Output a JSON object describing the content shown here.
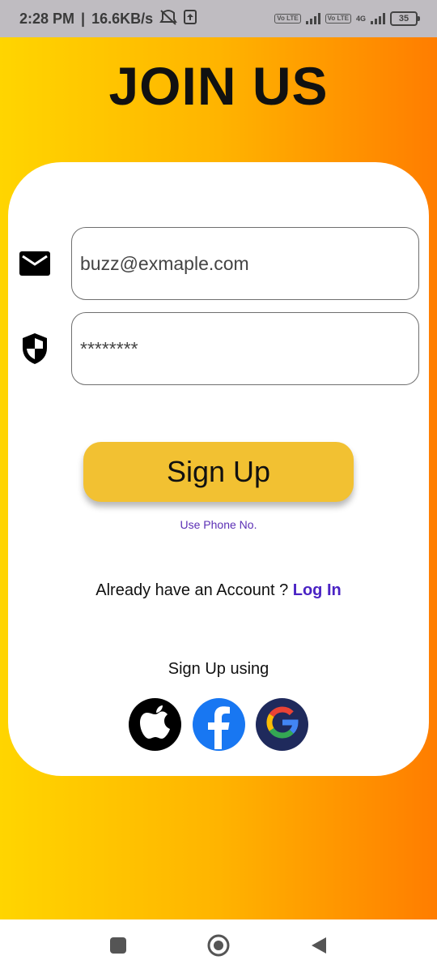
{
  "status_bar": {
    "time": "2:28 PM",
    "separator": "|",
    "speed": "16.6KB/s",
    "sim1_label": "Vo LTE",
    "sim2_label": "Vo LTE",
    "network_label": "4G",
    "battery": "35"
  },
  "title": "JOIN US",
  "form": {
    "email_value": "buzz@exmaple.com",
    "password_value": "********"
  },
  "signup_button": "Sign Up",
  "phone_link": "Use Phone No.",
  "login": {
    "prompt": "Already have an Account ? ",
    "link": "Log In"
  },
  "social": {
    "label": "Sign Up using",
    "providers": [
      "apple",
      "facebook",
      "google"
    ]
  },
  "colors": {
    "gradient_start": "#ffd500",
    "gradient_end": "#ff7d00",
    "button": "#f2c132",
    "link": "#4a23c4"
  }
}
